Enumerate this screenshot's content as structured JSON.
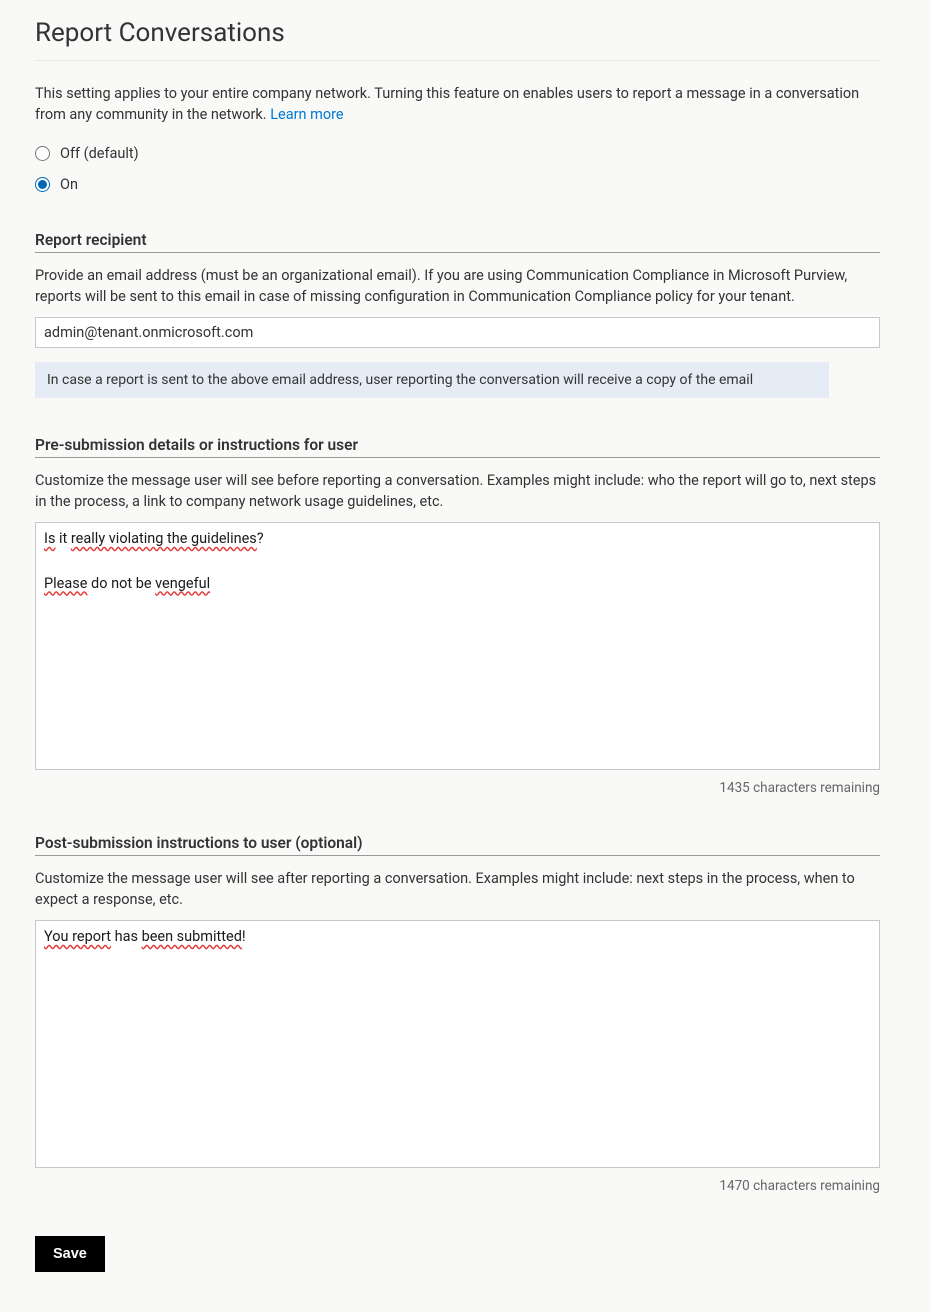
{
  "header": {
    "title": "Report Conversations"
  },
  "intro": {
    "text": "This setting applies to your entire company network. Turning this feature on enables users to report a message in a conversation from any community in the network. ",
    "link_label": "Learn more"
  },
  "radios": {
    "off_label": "Off (default)",
    "on_label": "On",
    "selected": "on"
  },
  "recipient": {
    "title": "Report recipient",
    "desc": "Provide an email address (must be an organizational email). If you are using Communication Compliance in Microsoft Purview, reports will be sent to this email in case of missing configuration in Communication Compliance policy for your tenant.",
    "value": "admin@tenant.onmicrosoft.com",
    "note": "In case a report is sent to the above email address, user reporting the conversation will receive a copy of the email"
  },
  "pre": {
    "title": "Pre-submission details or instructions for user",
    "desc": "Customize the message user will see before reporting a conversation. Examples might include: who the report will go to, next steps in the process, a link to company network usage guidelines, etc.",
    "line1_plain": "Is it really violating the guidelines?",
    "line1_pre": " it ",
    "line1_w1": "Is",
    "line1_w2": "really violating the guidelines",
    "line1_after": "?",
    "line2_plain": "Please do not be vengeful",
    "line2_w1": "Please",
    "line2_mid": " do not be ",
    "line2_w2": "vengeful",
    "counter": "1435 characters remaining"
  },
  "post": {
    "title": "Post-submission instructions to user (optional)",
    "desc": "Customize the message user will see after reporting a conversation. Examples might include: next steps in the process, when to expect a response, etc.",
    "line1_w1": "You report",
    "line1_mid": " has ",
    "line1_w2": "been submitted",
    "line1_after": "!",
    "counter": "1470 characters remaining"
  },
  "buttons": {
    "save": "Save"
  }
}
